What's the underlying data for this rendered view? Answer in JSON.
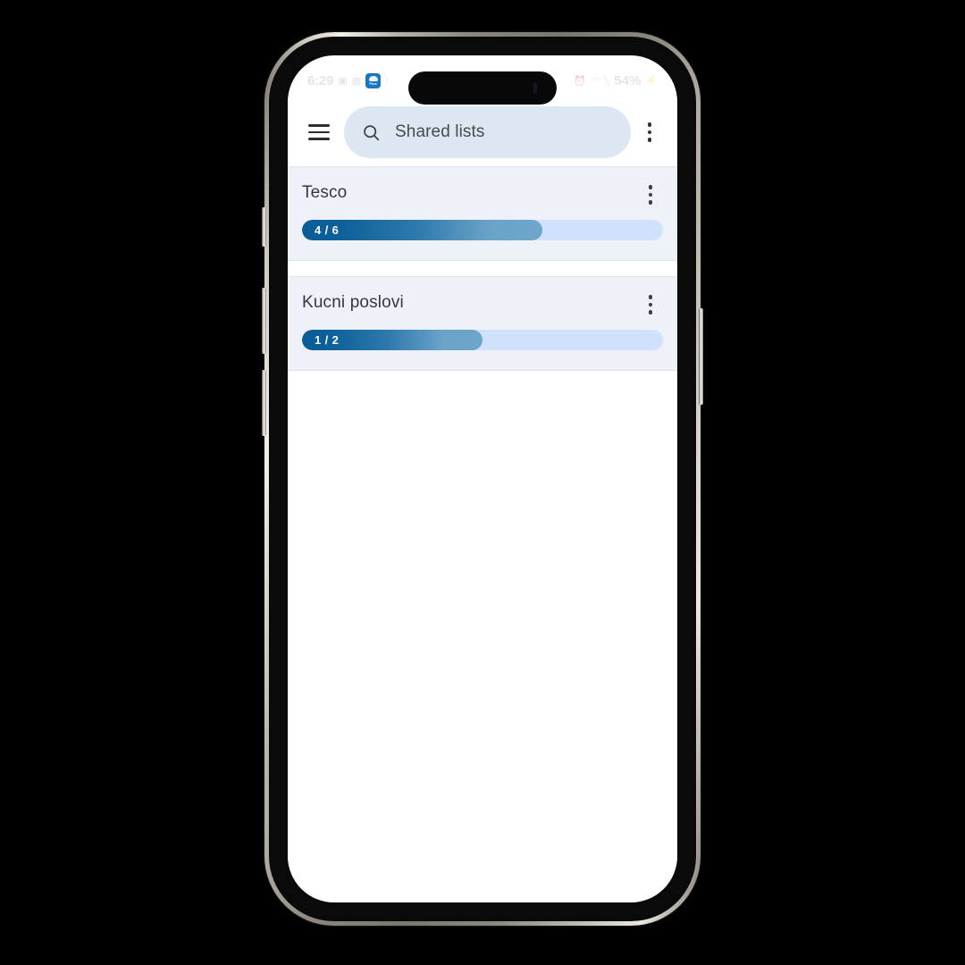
{
  "status_bar": {
    "time": "6:29",
    "left_icons": [
      "photo-icon",
      "sim-icon"
    ],
    "app_badge": {
      "name": "app-badge-icon",
      "label": "Plus",
      "color": "#1877c4"
    },
    "right_icons": [
      "alarm-icon",
      "wifi-icon",
      "signal-icon"
    ],
    "battery": "54%"
  },
  "app_bar": {
    "menu_icon": "hamburger-menu-icon",
    "search": {
      "icon": "search-icon",
      "value": "",
      "placeholder": "Shared lists"
    },
    "overflow_icon": "more-vertical-icon"
  },
  "lists": [
    {
      "title": "Tesco",
      "progress_label": "4 / 6",
      "completed": 4,
      "total": 6,
      "percent": 66.7,
      "menu_icon": "more-vertical-icon"
    },
    {
      "title": "Kucni poslovi",
      "progress_label": "1 / 2",
      "completed": 1,
      "total": 2,
      "percent": 50,
      "menu_icon": "more-vertical-icon"
    }
  ],
  "colors": {
    "card_bg": "#eef2f8",
    "search_bg": "#dde7f1",
    "progress_track": "#cfe1fb",
    "progress_fill_start": "#0a5c96",
    "progress_fill_end": "#6ea6ca",
    "screen_bg": "#ffffff"
  }
}
